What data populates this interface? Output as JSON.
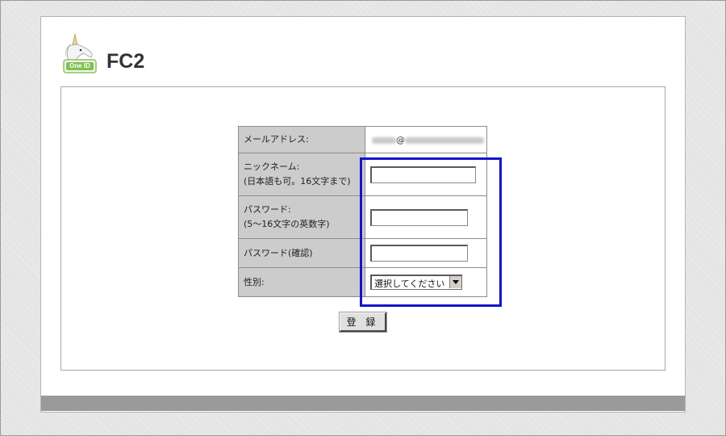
{
  "brand": {
    "name": "FC2",
    "badge": "One ID"
  },
  "form": {
    "email": {
      "label": "メールアドレス:",
      "at": "@"
    },
    "nickname": {
      "label_line1": "ニックネーム:",
      "label_line2": "(日本語も可。16文字まで)",
      "value": ""
    },
    "password": {
      "label_line1": "パスワード:",
      "label_line2": "(5〜16文字の英数字)",
      "value": ""
    },
    "password_confirm": {
      "label": "パスワード(確認)",
      "value": ""
    },
    "gender": {
      "label": "性別:",
      "selected": "選択してください"
    },
    "submit_label": "登 録"
  },
  "colors": {
    "highlight": "#1414cc",
    "label_bg": "#cccccc",
    "footer_bar": "#9a9a9a",
    "badge_green": "#7cc34a"
  },
  "icons": {
    "logo": "unicorn-logo-icon",
    "dropdown": "chevron-down-icon"
  }
}
